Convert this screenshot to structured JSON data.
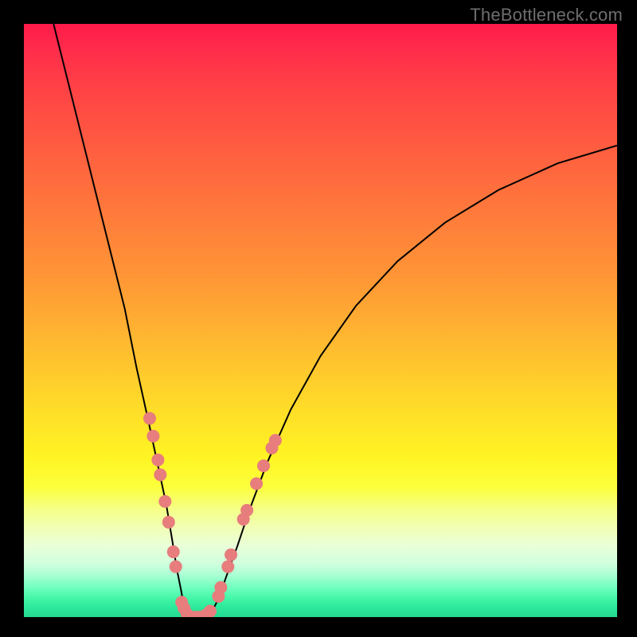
{
  "watermark": "TheBottleneck.com",
  "chart_data": {
    "type": "line",
    "title": "",
    "xlabel": "",
    "ylabel": "",
    "xlim": [
      0,
      100
    ],
    "ylim": [
      0,
      100
    ],
    "series": [
      {
        "name": "curve",
        "x": [
          5,
          8,
          11,
          14,
          17,
          19,
          21,
          22.5,
          24,
          25,
          25.8,
          26.5,
          27,
          27.5,
          28,
          29,
          30,
          31,
          32,
          33,
          34,
          36,
          38,
          41,
          45,
          50,
          56,
          63,
          71,
          80,
          90,
          100
        ],
        "y": [
          100,
          88,
          76,
          64,
          52,
          42,
          33,
          26,
          19,
          13,
          8,
          4.5,
          1.8,
          0.5,
          0,
          0,
          0,
          0.4,
          1.5,
          3.5,
          6.5,
          12,
          18,
          26,
          35,
          44,
          52.5,
          60,
          66.5,
          72,
          76.5,
          79.5
        ]
      }
    ],
    "markers": {
      "name": "dots",
      "points": [
        {
          "x": 21.2,
          "y": 33.5
        },
        {
          "x": 21.8,
          "y": 30.5
        },
        {
          "x": 22.6,
          "y": 26.5
        },
        {
          "x": 23.0,
          "y": 24.0
        },
        {
          "x": 23.8,
          "y": 19.5
        },
        {
          "x": 24.4,
          "y": 16.0
        },
        {
          "x": 25.2,
          "y": 11.0
        },
        {
          "x": 25.6,
          "y": 8.5
        },
        {
          "x": 26.6,
          "y": 2.5
        },
        {
          "x": 27.0,
          "y": 1.5
        },
        {
          "x": 27.5,
          "y": 0.5
        },
        {
          "x": 28.2,
          "y": 0.0
        },
        {
          "x": 29.0,
          "y": 0.0
        },
        {
          "x": 29.8,
          "y": 0.0
        },
        {
          "x": 30.6,
          "y": 0.3
        },
        {
          "x": 31.4,
          "y": 1.0
        },
        {
          "x": 32.8,
          "y": 3.5
        },
        {
          "x": 33.2,
          "y": 5.0
        },
        {
          "x": 34.4,
          "y": 8.5
        },
        {
          "x": 34.9,
          "y": 10.5
        },
        {
          "x": 37.0,
          "y": 16.5
        },
        {
          "x": 37.6,
          "y": 18.0
        },
        {
          "x": 39.2,
          "y": 22.5
        },
        {
          "x": 40.4,
          "y": 25.5
        },
        {
          "x": 41.8,
          "y": 28.5
        },
        {
          "x": 42.4,
          "y": 29.8
        }
      ]
    },
    "marker_color": "#e77d7d",
    "curve_color": "#000000"
  }
}
